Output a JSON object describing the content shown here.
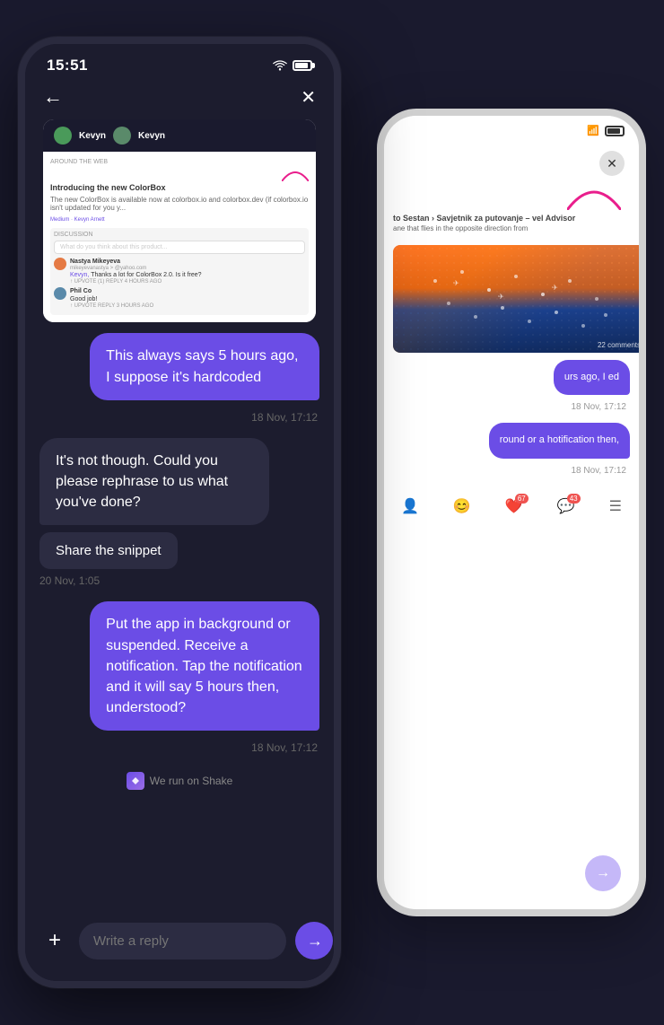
{
  "scene": {
    "background_color": "#1a1a2e"
  },
  "status_bar": {
    "time": "15:51",
    "wifi": "wifi",
    "battery": "battery"
  },
  "nav": {
    "back_label": "←",
    "close_label": "✕"
  },
  "screenshot": {
    "user1": "Kevyn",
    "user2": "Kevyn",
    "article_title": "Introducing the new ColorBox",
    "article_subtitle": "The new ColorBox is available now at colorbox.io and colorbox.dev (if colorbox.io isn't updated for you y...",
    "source": "Medium · Kevyn Arnett",
    "discussion_label": "DISCUSSION",
    "discussion_placeholder": "What do you think about this product...",
    "comment1_name": "Nastya Mikeyeva",
    "comment1_email": "mikeyevanastya > @yahoo.com",
    "comment1_mention": "Kevyn,",
    "comment1_text": "Thanks a lot for ColorBox 2.0. Is it free?",
    "comment1_meta": "↑ UPVOTE (1)  REPLY  4 HOURS AGO",
    "comment2_name": "Phil Co",
    "comment2_text": "Good job!",
    "comment2_meta": "↑ UPVOTE  REPLY  3 HOURS AGO"
  },
  "messages": [
    {
      "id": "msg1",
      "type": "sent",
      "text": "This always says 5 hours ago, I suppose it's hardcoded",
      "timestamp": "18 Nov, 17:12"
    },
    {
      "id": "msg2",
      "type": "received",
      "text": "It's not though. Could you please rephrase to us what you've done?",
      "timestamp": null
    },
    {
      "id": "msg3",
      "type": "snippet",
      "text": "Share the snippet",
      "timestamp": "20 Nov, 1:05"
    },
    {
      "id": "msg4",
      "type": "sent",
      "text": "Put the app in background or suspended. Receive a notification. Tap the notification and it will say 5 hours then, understood?",
      "timestamp": "18 Nov, 17:12"
    }
  ],
  "shake_notice": {
    "text": "We run on Shake"
  },
  "input": {
    "placeholder": "Write a reply",
    "add_label": "+",
    "send_label": "→"
  },
  "bg_phone": {
    "close_label": "✕",
    "bubble_text": "urs ago, I\ned",
    "timestamp": "18 Nov, 17:12",
    "bubble2_text": "round or\na\nhotification\nthen,",
    "timestamp2": "18 Nov, 17:12"
  }
}
